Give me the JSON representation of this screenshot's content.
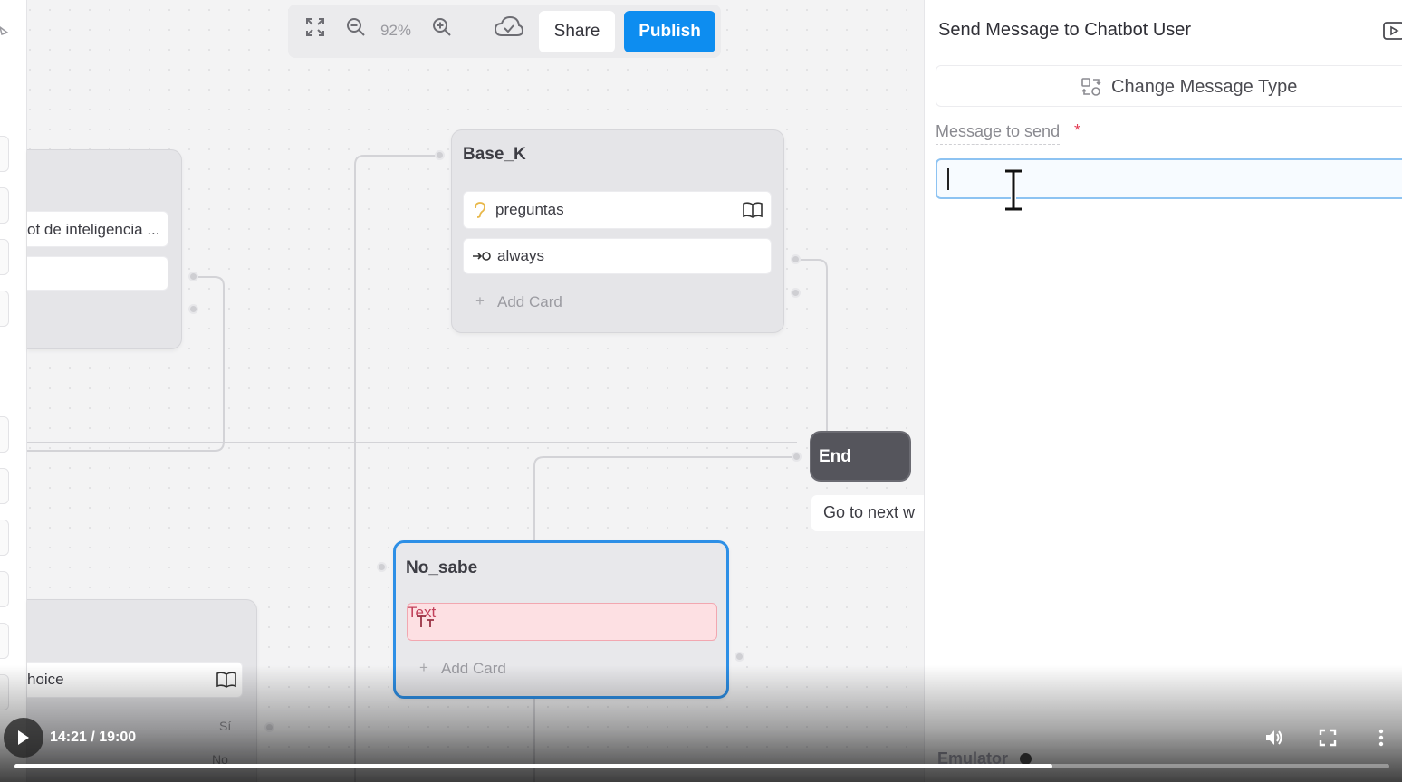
{
  "toolbar": {
    "zoom_level": "92%",
    "share_label": "Share",
    "publish_label": "Publish",
    "colors": {
      "publish": "#0d8df0"
    }
  },
  "canvas": {
    "left_top_node": {
      "card_1_text": "ot de inteligencia ..."
    },
    "left_bottom_node": {
      "card_1_text": "hoice",
      "option_1": "Sí",
      "option_2": "No"
    },
    "basek_node": {
      "title": "Base_K",
      "cards": [
        {
          "icon": "ear-icon",
          "label": "preguntas"
        },
        {
          "icon": "arrow-circle-icon",
          "label": "always"
        }
      ],
      "add_card_label": "Add Card"
    },
    "end_node": {
      "title": "End",
      "next_label": "Go to next w"
    },
    "nosabe_node": {
      "title": "No_sabe",
      "text_card_label": "Text",
      "add_card_label": "Add Card",
      "colors": {
        "border": "#2d8fe6",
        "text_card_bg": "#fde0e3"
      }
    }
  },
  "panel": {
    "title": "Send Message to Chatbot User",
    "change_type_label": "Change Message Type",
    "message_label": "Message to send",
    "required_mark": "*",
    "message_value": "",
    "emulator_label": "Emulator"
  },
  "video": {
    "time": "14:21 / 19:00",
    "progress": 0.755
  }
}
